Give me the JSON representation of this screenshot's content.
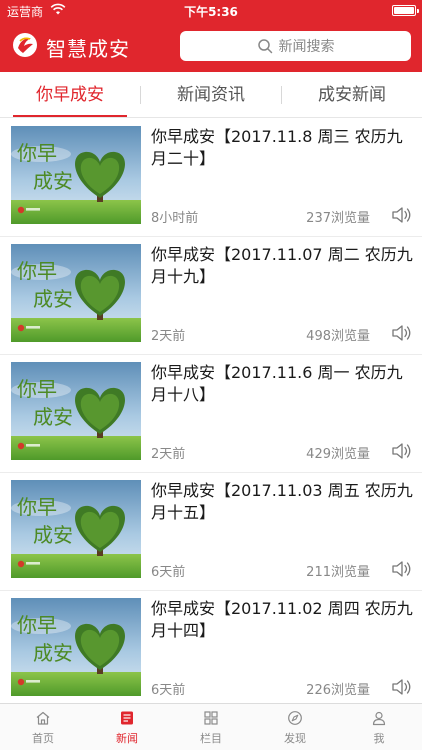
{
  "status_bar": {
    "carrier": "运营商",
    "time": "下午5:36"
  },
  "header": {
    "app_title": "智慧成安",
    "search_placeholder": "新闻搜索"
  },
  "tabs": [
    {
      "label": "你早成安",
      "active": true
    },
    {
      "label": "新闻资讯",
      "active": false
    },
    {
      "label": "成安新闻",
      "active": false
    }
  ],
  "thumbnail_text": {
    "line1": "你早",
    "line2": "成安"
  },
  "articles": [
    {
      "title": "你早成安【2017.11.8  周三  农历九月二十】",
      "time": "8小时前",
      "views": "237浏览量"
    },
    {
      "title": "你早成安【2017.11.07  周二   农历九月十九】",
      "time": "2天前",
      "views": "498浏览量"
    },
    {
      "title": "你早成安【2017.11.6  周一  农历九月十八】",
      "time": "2天前",
      "views": "429浏览量"
    },
    {
      "title": "你早成安【2017.11.03  周五 农历九月十五】",
      "time": "6天前",
      "views": "211浏览量"
    },
    {
      "title": "你早成安【2017.11.02  周四  农历九月十四】",
      "time": "6天前",
      "views": "226浏览量"
    }
  ],
  "tabbar": [
    {
      "label": "首页",
      "icon": "home-icon",
      "active": false
    },
    {
      "label": "新闻",
      "icon": "news-icon",
      "active": true
    },
    {
      "label": "栏目",
      "icon": "grid-icon",
      "active": false
    },
    {
      "label": "发现",
      "icon": "compass-icon",
      "active": false
    },
    {
      "label": "我",
      "icon": "user-icon",
      "active": false
    }
  ],
  "colors": {
    "brand_red": "#e0262d",
    "text_gray": "#888888"
  }
}
